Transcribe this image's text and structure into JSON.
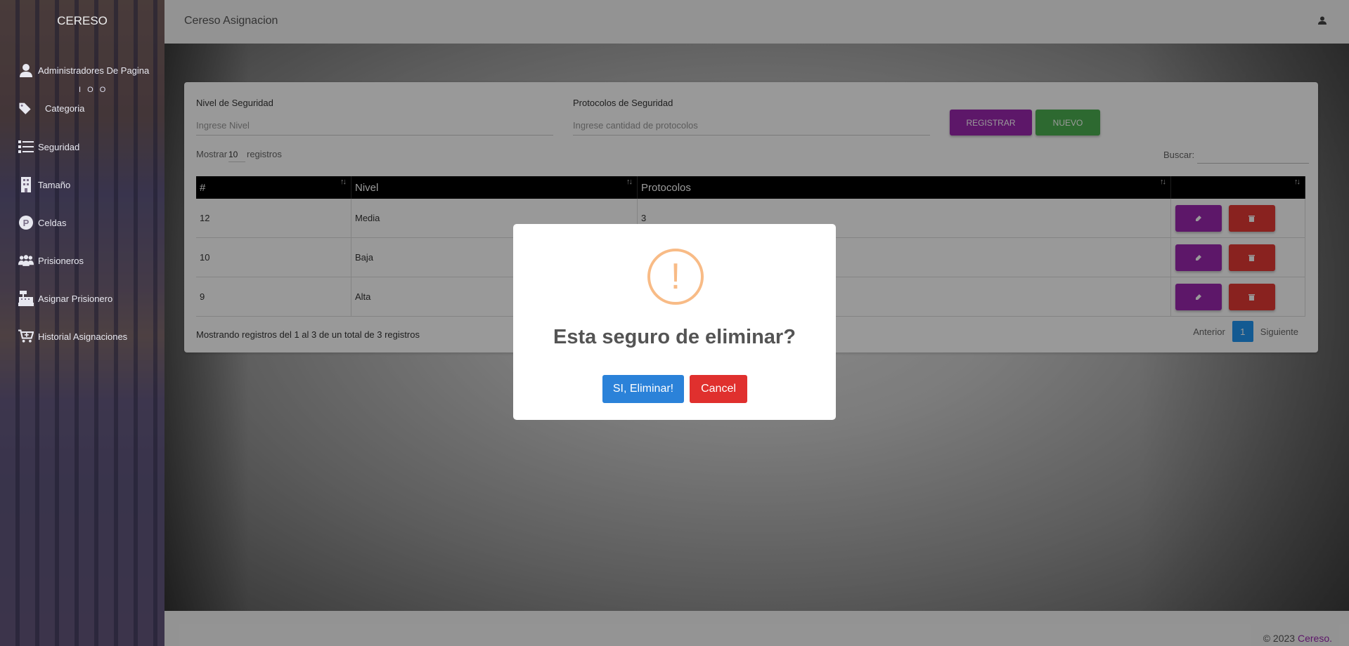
{
  "sidebar": {
    "brand": "CERESO",
    "logo_text": "I O O",
    "items": [
      {
        "label": "Administradores De Pagina",
        "icon": "user-icon"
      },
      {
        "label": "Categoria",
        "icon": "tags-icon"
      },
      {
        "label": "Seguridad",
        "icon": "list-icon"
      },
      {
        "label": "Tamaño",
        "icon": "building-icon"
      },
      {
        "label": "Celdas",
        "icon": "parking-icon"
      },
      {
        "label": "Prisioneros",
        "icon": "users-icon"
      },
      {
        "label": "Asignar Prisionero",
        "icon": "cash-register-icon"
      },
      {
        "label": "Historial Asignaciones",
        "icon": "cart-plus-icon"
      }
    ]
  },
  "navbar": {
    "title": "Cereso Asignacion",
    "user_icon": "user-icon"
  },
  "form": {
    "nivel_label": "Nivel de Seguridad",
    "nivel_placeholder": "Ingrese Nivel",
    "protocolos_label": "Protocolos de Seguridad",
    "protocolos_placeholder": "Ingrese cantidad de protocolos",
    "registrar_label": "REGISTRAR",
    "nuevo_label": "NUEVO"
  },
  "table_controls": {
    "show_prefix": "Mostrar",
    "show_value": "10",
    "show_suffix": "registros",
    "search_label": "Buscar:"
  },
  "table": {
    "columns": [
      "#",
      "Nivel",
      "Protocolos",
      ""
    ],
    "rows": [
      {
        "id": "12",
        "nivel": "Media",
        "protocolos": "3"
      },
      {
        "id": "10",
        "nivel": "Baja",
        "protocolos": ""
      },
      {
        "id": "9",
        "nivel": "Alta",
        "protocolos": ""
      }
    ]
  },
  "table_info": "Mostrando registros del 1 al 3 de un total de 3 registros",
  "pagination": {
    "previous": "Anterior",
    "page": "1",
    "next": "Siguiente"
  },
  "footer": {
    "copyright": "© 2023",
    "brand": "Cereso."
  },
  "modal": {
    "icon": "!",
    "title": "Esta seguro de eliminar?",
    "confirm_label": "SI, Eliminar!",
    "cancel_label": "Cancel"
  },
  "colors": {
    "purple": "#9c27b0",
    "green": "#4caf50",
    "red": "#e53935",
    "blue": "#2196f3",
    "warning": "#f8bb86"
  }
}
